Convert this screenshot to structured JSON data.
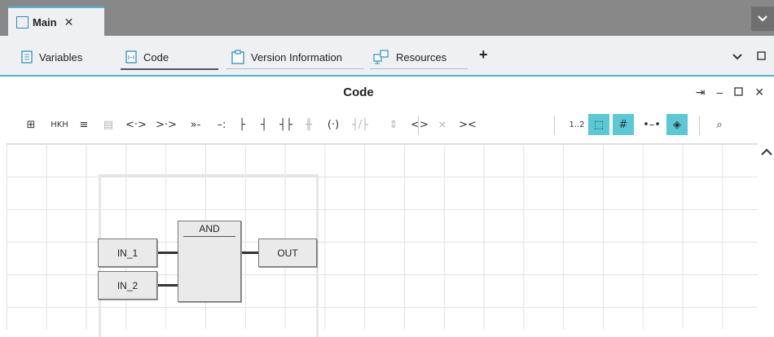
{
  "doc_tab": {
    "label": "Main",
    "close": "✕"
  },
  "editor_tabs": [
    {
      "label": "Variables"
    },
    {
      "label": "Code"
    },
    {
      "label": "Version Information"
    },
    {
      "label": "Resources"
    }
  ],
  "add_tab": "+",
  "panel": {
    "title": "Code"
  },
  "toolbar": [
    {
      "name": "insert-element-icon",
      "glyph": "⊞"
    },
    {
      "name": "network-comment-icon",
      "glyph": "HKH"
    },
    {
      "name": "align-lines-icon",
      "glyph": "≡"
    },
    {
      "name": "comment-icon",
      "glyph": "▤",
      "disabled": true
    },
    {
      "name": "contact-pair-icon",
      "glyph": "<·>"
    },
    {
      "name": "insert-after-icon",
      "glyph": ">·>"
    },
    {
      "name": "insert-right-icon",
      "glyph": "»-"
    },
    {
      "name": "output-coil-icon",
      "glyph": "–:"
    },
    {
      "name": "left-rail-icon",
      "glyph": "├"
    },
    {
      "name": "right-rail-icon",
      "glyph": "┤"
    },
    {
      "name": "contact-icon",
      "glyph": "┤├"
    },
    {
      "name": "parallel-contact-icon",
      "glyph": "╫",
      "disabled": true
    },
    {
      "name": "coil-icon",
      "glyph": "(·)"
    },
    {
      "name": "negated-contact-icon",
      "glyph": "┤/├",
      "disabled": true
    },
    {
      "name": "expand-vertical-icon",
      "glyph": "⇕",
      "disabled": true
    },
    {
      "name": "expand-horizontal-icon",
      "glyph": "<>"
    },
    {
      "name": "collapse-vertical-icon",
      "glyph": "⨯",
      "disabled": true
    },
    {
      "name": "collapse-horizontal-icon",
      "glyph": "><"
    },
    {
      "name": "execution-order-icon",
      "glyph": "1..2"
    },
    {
      "name": "block-frame-icon",
      "glyph": "⬚",
      "active": true
    },
    {
      "name": "grid-icon",
      "glyph": "#",
      "active": true
    },
    {
      "name": "connection-line-icon",
      "glyph": "•–•"
    },
    {
      "name": "auto-route-icon",
      "glyph": "◈",
      "active": true
    },
    {
      "name": "search-icon",
      "glyph": "⌕"
    }
  ],
  "diagram": {
    "block": {
      "name": "AND"
    },
    "inputs": [
      "IN_1",
      "IN_2"
    ],
    "output": "OUT"
  },
  "colors": {
    "accent": "#4fb3d9",
    "active_tool": "#5bc8d6",
    "tabbar": "#888888"
  }
}
